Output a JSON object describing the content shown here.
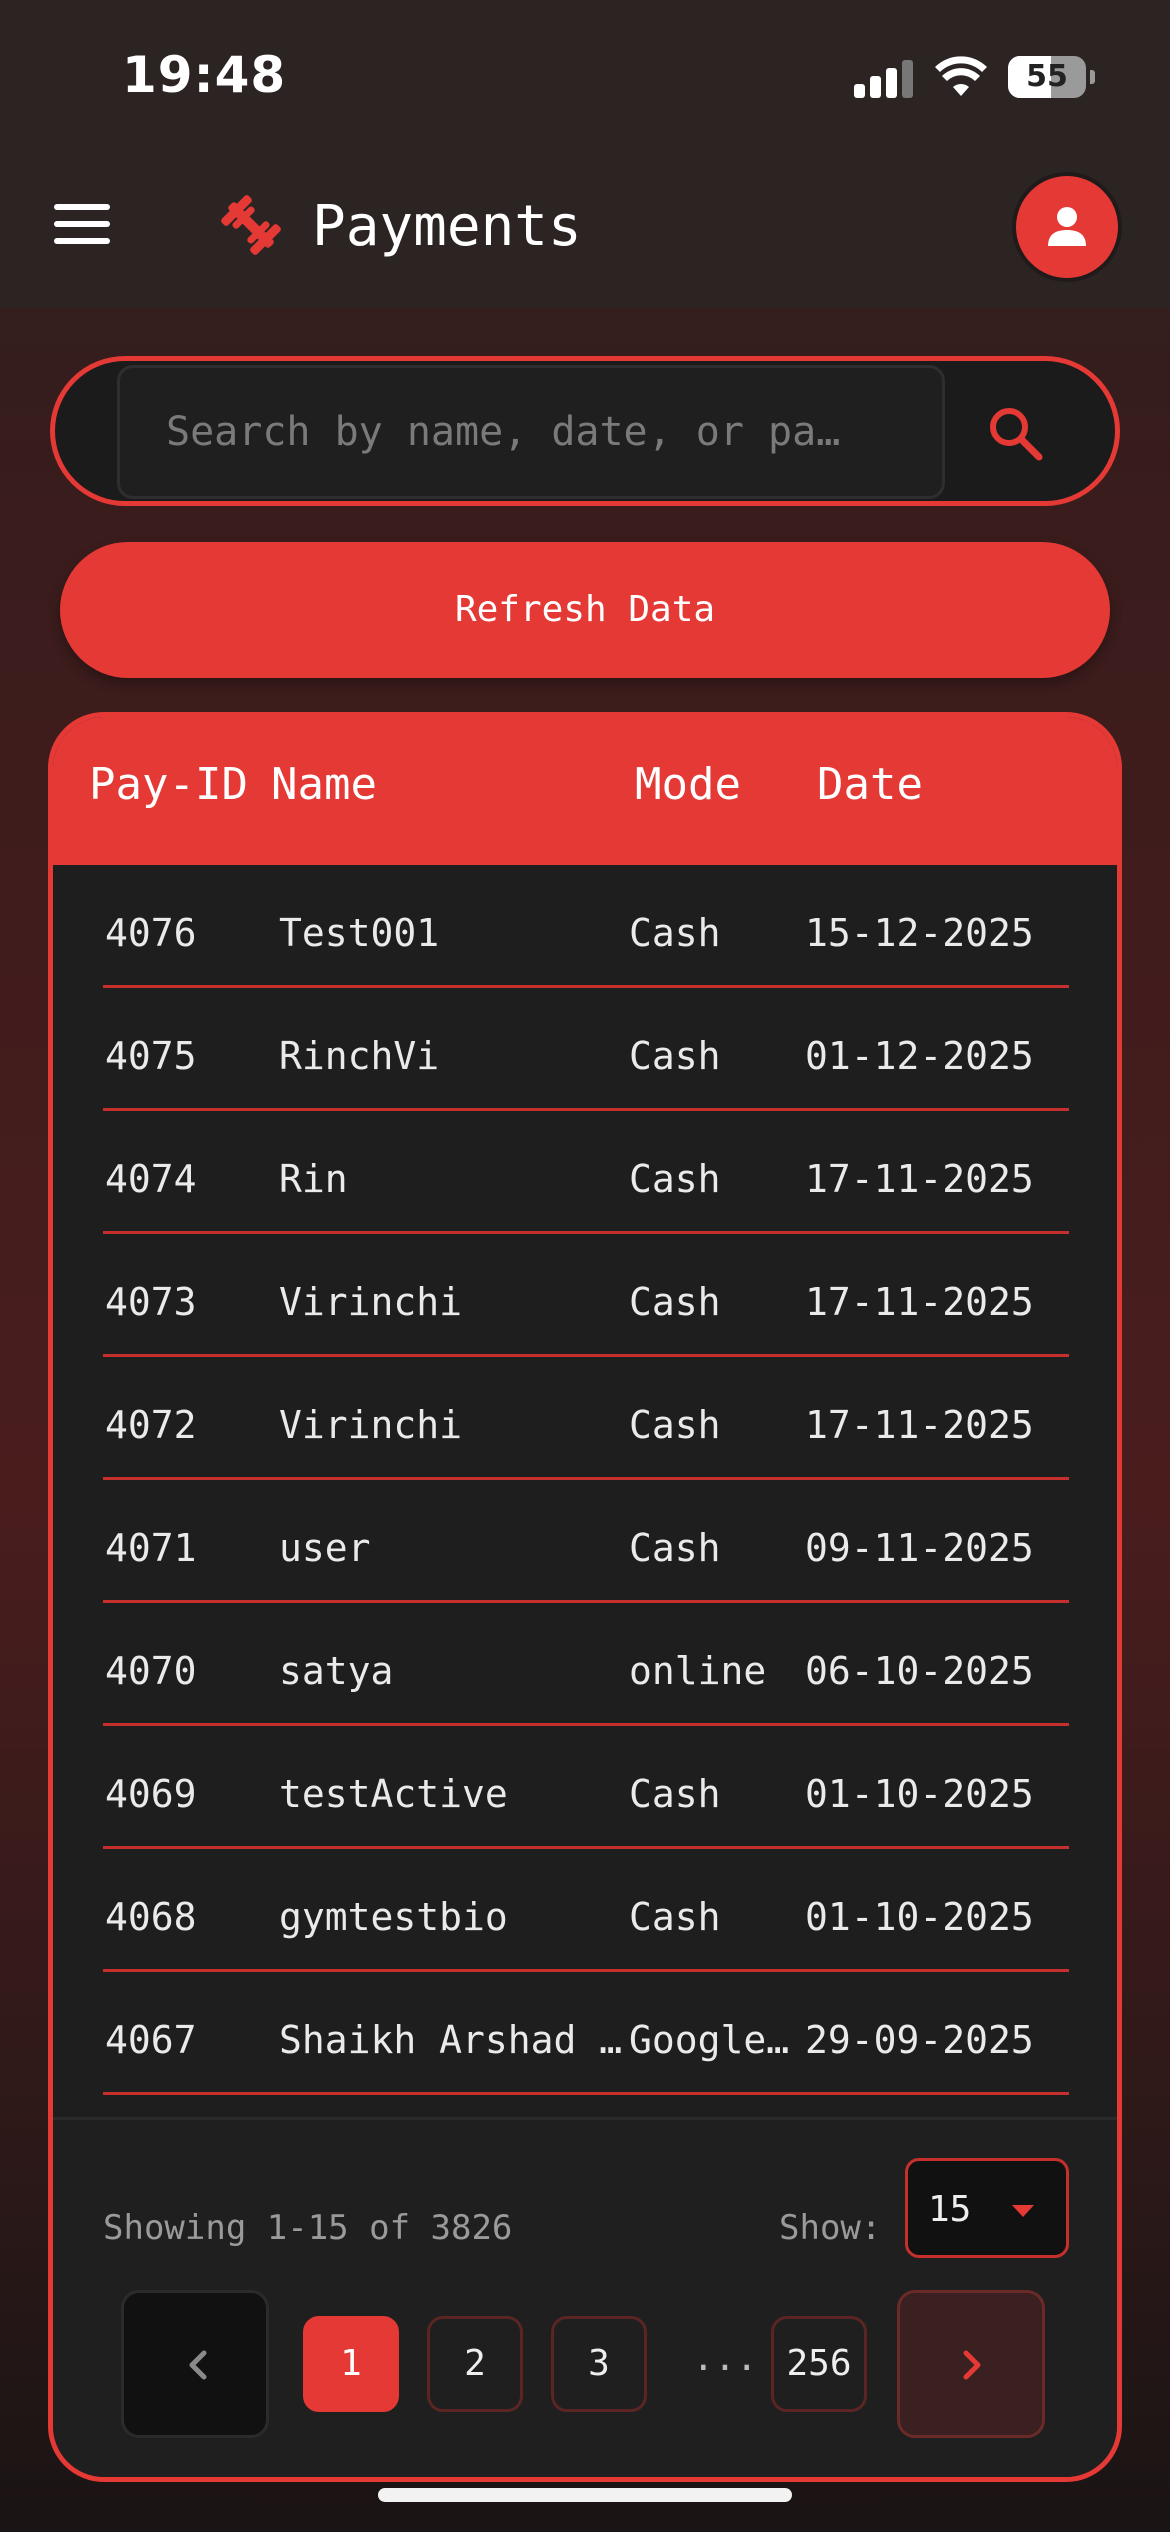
{
  "status_bar": {
    "time": "19:48",
    "battery": "55",
    "battery_level": 0.55
  },
  "app_bar": {
    "title": "Payments",
    "menu_icon": "hamburger-menu-icon",
    "logo_icon": "dumbbell-icon",
    "profile_icon": "user-icon"
  },
  "search": {
    "placeholder": "Search by name, date, or pa…",
    "value": "",
    "icon": "search-icon"
  },
  "refresh": {
    "label": "Refresh Data"
  },
  "table": {
    "headers": {
      "id": "Pay-ID",
      "name": "Name",
      "mode": "Mode",
      "date": "Date"
    },
    "rows": [
      {
        "id": "4076",
        "name": "Test001",
        "mode": "Cash",
        "date": "15-12-2025"
      },
      {
        "id": "4075",
        "name": "RinchVi",
        "mode": "Cash",
        "date": "01-12-2025"
      },
      {
        "id": "4074",
        "name": "Rin",
        "mode": "Cash",
        "date": "17-11-2025"
      },
      {
        "id": "4073",
        "name": "Virinchi",
        "mode": "Cash",
        "date": "17-11-2025"
      },
      {
        "id": "4072",
        "name": "Virinchi",
        "mode": "Cash",
        "date": "17-11-2025"
      },
      {
        "id": "4071",
        "name": "user",
        "mode": "Cash",
        "date": "09-11-2025"
      },
      {
        "id": "4070",
        "name": "satya",
        "mode": "online",
        "date": "06-10-2025"
      },
      {
        "id": "4069",
        "name": "testActive",
        "mode": "Cash",
        "date": "01-10-2025"
      },
      {
        "id": "4068",
        "name": "gymtestbio",
        "mode": "Cash",
        "date": "01-10-2025"
      },
      {
        "id": "4067",
        "name": "Shaikh Arshad …",
        "mode": "Google…",
        "date": "29-09-2025"
      }
    ]
  },
  "footer": {
    "showing": "Showing 1-15 of 3826",
    "show_label": "Show:",
    "show_value": "15"
  },
  "pagination": {
    "pages": [
      "1",
      "2",
      "3",
      "256"
    ],
    "ellipsis": "...",
    "active_page": "1"
  },
  "colors": {
    "accent": "#e53935",
    "background": "#1e1e1e",
    "header": "#2c2323"
  }
}
